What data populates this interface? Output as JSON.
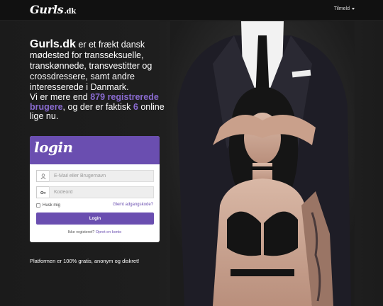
{
  "navbar": {
    "brand": "Gurls",
    "brand_tld": ".dk",
    "menu_label": "Tilmeld"
  },
  "intro": {
    "site_name": "Gurls.dk",
    "text1": " er et frækt dansk mødested for transseksuelle, transkønnede, transvestitter og crossdressere, samt andre interesserede i Danmark.",
    "text2_a": "Vi er mere end ",
    "registered_count": "879 registrerede brugere",
    "text2_b": ", og der er faktisk ",
    "online_count": "6",
    "text2_c": " online lige nu."
  },
  "login": {
    "title": "login",
    "email_placeholder": "E-Mail eller Brugernavn",
    "password_placeholder": "Kodeord",
    "remember_label": "Husk mig",
    "forgot_label": "Glemt adgangskode?",
    "button_label": "Login",
    "register_prompt": "Ikke registeret?",
    "register_link": "Opret en konto"
  },
  "tagline": "Platformen er 100% gratis, anonym og diskret!",
  "colors": {
    "accent": "#6a4eb0",
    "highlight": "#8a6bd0",
    "background": "#1a1a1a"
  },
  "icons": {
    "email": "user-icon",
    "password": "key-icon",
    "menu": "caret-down-icon"
  }
}
